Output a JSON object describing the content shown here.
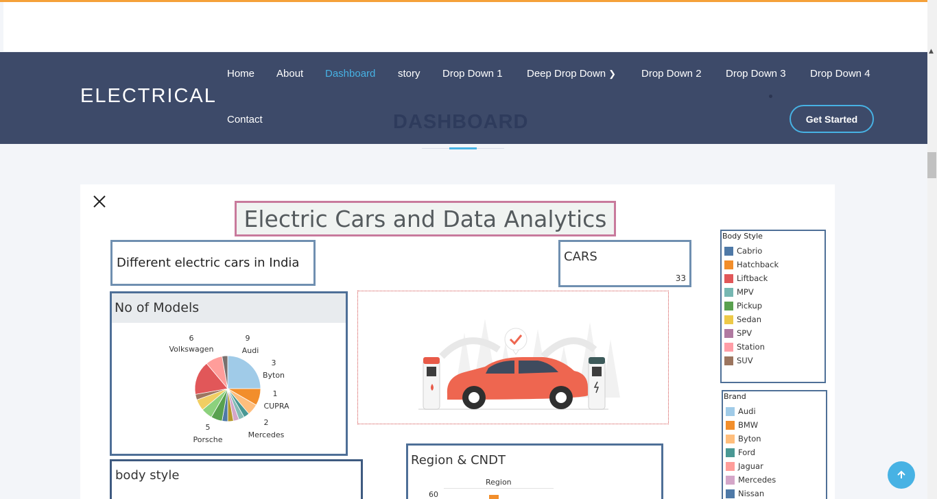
{
  "site": {
    "logo": "ELECTRICAL",
    "hero_title": "DASHBOARD",
    "cta_label": "Get Started"
  },
  "nav": {
    "items": [
      {
        "label": "Home"
      },
      {
        "label": "About"
      },
      {
        "label": "Dashboard",
        "active": true
      },
      {
        "label": "story"
      },
      {
        "label": "Drop Down 1"
      },
      {
        "label": "Deep Drop Down",
        "has_submenu": true
      },
      {
        "label": "Drop Down 2"
      },
      {
        "label": "Drop Down 3"
      },
      {
        "label": "Drop Down 4"
      },
      {
        "label": "Contact"
      }
    ]
  },
  "dashboard": {
    "title": "Electric Cars and Data Analytics",
    "subtitle": "Different electric cars in India",
    "cars_card": {
      "label": "CARS",
      "value": "33"
    },
    "models_card": {
      "title": "No of Models",
      "labels": [
        {
          "count": "6",
          "brand": "Volkswagen"
        },
        {
          "count": "9",
          "brand": "Audi"
        },
        {
          "count": "3",
          "brand": "Byton"
        },
        {
          "count": "1",
          "brand": "CUPRA"
        },
        {
          "count": "2",
          "brand": "Mercedes"
        },
        {
          "count": "5",
          "brand": "Porsche"
        }
      ]
    },
    "body_style_card": {
      "title": "body style"
    },
    "region_card": {
      "title": "Region & CNDT",
      "subtitle": "Region",
      "axis_tick": "60"
    },
    "legend_body_style": {
      "title": "Body Style",
      "items": [
        {
          "label": "Cabrio",
          "color": "#4e79a7"
        },
        {
          "label": "Hatchback",
          "color": "#f28e2b"
        },
        {
          "label": "Liftback",
          "color": "#e15759"
        },
        {
          "label": "MPV",
          "color": "#76b7b2"
        },
        {
          "label": "Pickup",
          "color": "#59a14f"
        },
        {
          "label": "Sedan",
          "color": "#edc948"
        },
        {
          "label": "SPV",
          "color": "#b07aa1"
        },
        {
          "label": "Station",
          "color": "#ff9da7"
        },
        {
          "label": "SUV",
          "color": "#9c755f"
        }
      ]
    },
    "legend_brand": {
      "title": "Brand",
      "items": [
        {
          "label": "Audi",
          "color": "#a0cbe8"
        },
        {
          "label": "BMW",
          "color": "#f28e2b"
        },
        {
          "label": "Byton",
          "color": "#ffbe7d"
        },
        {
          "label": "Ford",
          "color": "#499894"
        },
        {
          "label": "Jaguar",
          "color": "#ff9d9a"
        },
        {
          "label": "Mercedes",
          "color": "#d4a6c8"
        },
        {
          "label": "Nissan",
          "color": "#4e79a7"
        }
      ]
    }
  },
  "chart_data": {
    "type": "pie",
    "title": "No of Models",
    "labels": [
      "Volkswagen",
      "Audi",
      "Byton",
      "CUPRA",
      "Mercedes",
      "Porsche"
    ],
    "values": [
      6,
      9,
      3,
      1,
      2,
      5
    ]
  },
  "icons": {
    "close": "close-icon",
    "scroll_top": "arrow-up-icon",
    "submenu": "chevron-right-icon"
  }
}
